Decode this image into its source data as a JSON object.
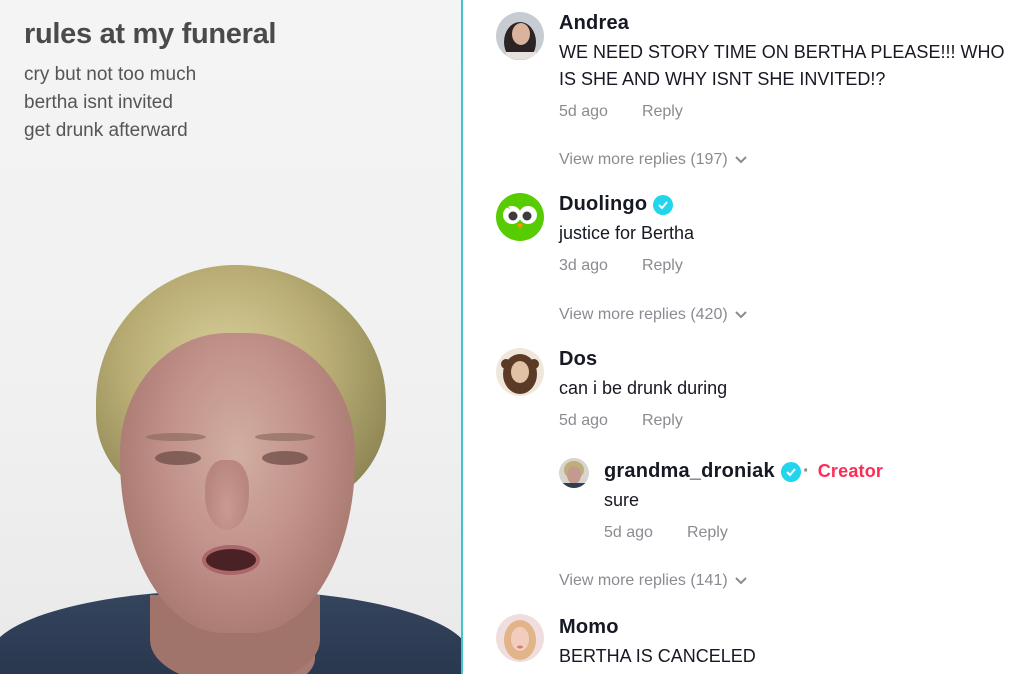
{
  "video": {
    "caption_title": "rules at my funeral",
    "caption_lines": [
      "cry but not too much",
      "bertha isnt invited",
      "get drunk afterward"
    ]
  },
  "comments": [
    {
      "username": "Andrea",
      "text": "WE NEED STORY TIME ON BERTHA PLEASE!!! WHO IS SHE AND WHY ISNT SHE INVITED!?",
      "time": "5d ago",
      "reply_label": "Reply",
      "view_more": "View more replies (197)"
    },
    {
      "username": "Duolingo",
      "verified": true,
      "text": "justice for Bertha",
      "time": "3d ago",
      "reply_label": "Reply",
      "view_more": "View more replies (420)"
    },
    {
      "username": "Dos",
      "text": "can i be drunk during",
      "time": "5d ago",
      "reply_label": "Reply",
      "reply": {
        "username": "grandma_droniak",
        "verified": true,
        "badge": "Creator",
        "text": "sure",
        "time": "5d ago",
        "reply_label": "Reply"
      },
      "view_more": "View more replies (141)"
    },
    {
      "username": "Momo",
      "text": "BERTHA IS CANCELED"
    }
  ],
  "colors": {
    "divider": "#3fc6c9",
    "verified": "#20d5ec",
    "creator": "#fe2c55",
    "duolingo_green": "#58cc02"
  },
  "icons": {
    "verified": "verified-check-icon",
    "chevron": "chevron-down-icon"
  }
}
